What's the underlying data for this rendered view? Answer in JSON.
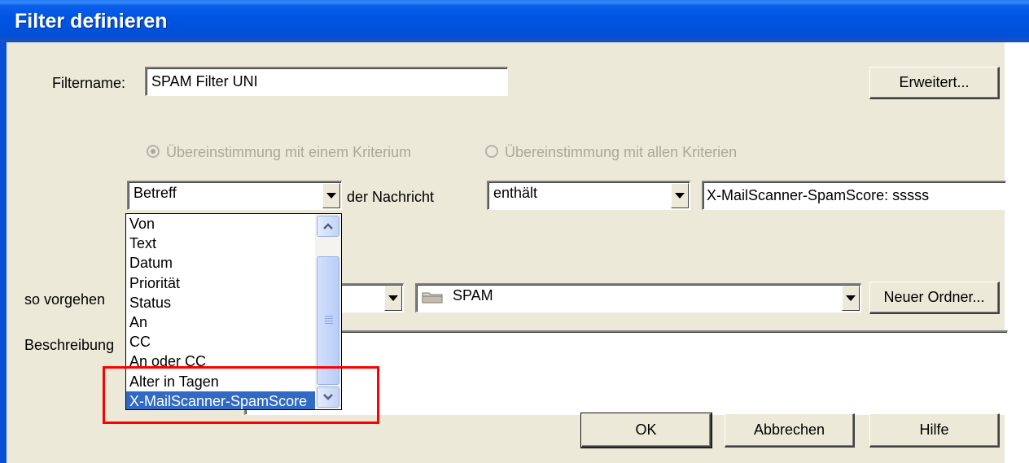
{
  "window": {
    "title": "Filter definieren"
  },
  "filtername": {
    "label": "Filtername:",
    "value": "SPAM Filter UNI"
  },
  "buttons": {
    "advanced": "Erweitert...",
    "new_folder": "Neuer Ordner...",
    "ok": "OK",
    "cancel": "Abbrechen",
    "help": "Hilfe"
  },
  "match": {
    "any": "Übereinstimmung mit einem Kriterium",
    "all": "Übereinstimmung mit allen Kriterien"
  },
  "criteria": {
    "field_selected": "Betreff",
    "suffix": "der Nachricht",
    "operator": "enthält",
    "value": "X-MailScanner-SpamScore: sssss"
  },
  "field_list": [
    "Von",
    "Text",
    "Datum",
    "Priorität",
    "Status",
    "An",
    "CC",
    "An oder CC",
    "Alter in Tagen",
    "X-MailScanner-SpamScore"
  ],
  "action": {
    "label": "so vorgehen",
    "folder": "SPAM"
  },
  "description": {
    "label": "Beschreibung"
  },
  "colors": {
    "title_bar": "#0054e3",
    "selection": "#316ac5",
    "annotation": "#ff0000"
  }
}
